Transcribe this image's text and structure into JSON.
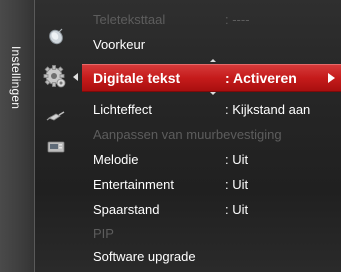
{
  "side_tab": {
    "label": "Instellingen"
  },
  "menu": {
    "rows": [
      {
        "name": "Teleteksttaal",
        "value": ": ----",
        "state": "disabled"
      },
      {
        "name": "Voorkeur",
        "value": "",
        "state": "normal"
      },
      {
        "name": "Digitale tekst",
        "value": ": Activeren",
        "state": "selected"
      },
      {
        "name": "Lichteffect",
        "value": ": Kijkstand aan",
        "state": "normal"
      },
      {
        "name": "Aanpassen van muurbevestiging",
        "value": "",
        "state": "disabled"
      },
      {
        "name": "Melodie",
        "value": ": Uit",
        "state": "normal"
      },
      {
        "name": "Entertainment",
        "value": ": Uit",
        "state": "normal"
      },
      {
        "name": "Spaarstand",
        "value": ": Uit",
        "state": "normal"
      },
      {
        "name": "PIP",
        "value": "",
        "state": "disabled"
      },
      {
        "name": "Software upgrade",
        "value": "",
        "state": "normal"
      }
    ]
  },
  "icons": {
    "category_1": "satellite-dish-icon",
    "category_2": "settings-gear-icon",
    "category_3": "input-plug-icon",
    "category_4": "application-icon"
  },
  "colors": {
    "highlight": "#c51b1b",
    "text": "#ffffff",
    "disabled_text": "#5d5d5d"
  }
}
